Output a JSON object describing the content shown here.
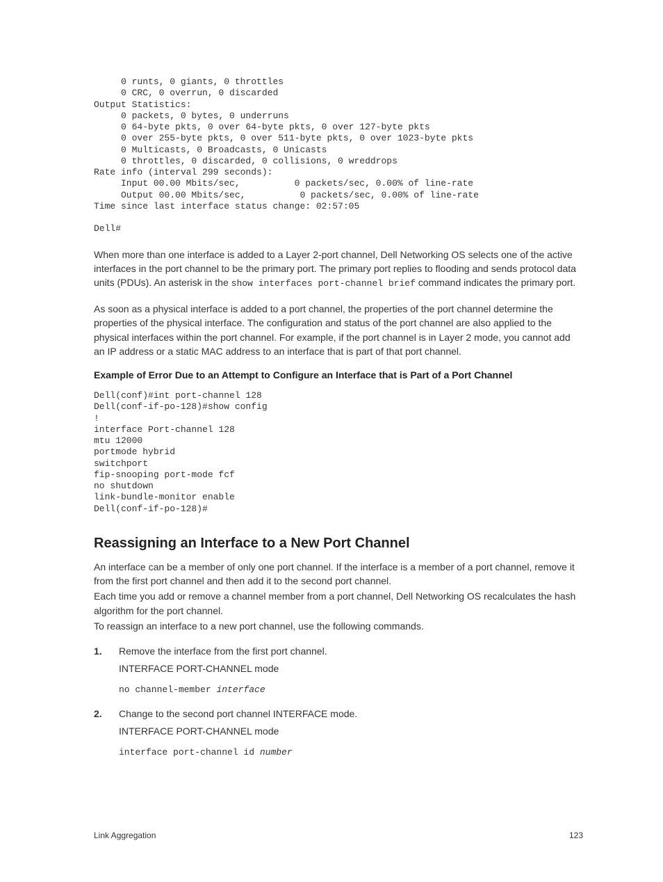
{
  "code_block_top": "     0 runts, 0 giants, 0 throttles\n     0 CRC, 0 overrun, 0 discarded\nOutput Statistics:\n     0 packets, 0 bytes, 0 underruns\n     0 64-byte pkts, 0 over 64-byte pkts, 0 over 127-byte pkts\n     0 over 255-byte pkts, 0 over 511-byte pkts, 0 over 1023-byte pkts\n     0 Multicasts, 0 Broadcasts, 0 Unicasts\n     0 throttles, 0 discarded, 0 collisions, 0 wreddrops\nRate info (interval 299 seconds):\n     Input 00.00 Mbits/sec,          0 packets/sec, 0.00% of line-rate\n     Output 00.00 Mbits/sec,          0 packets/sec, 0.00% of line-rate\nTime since last interface status change: 02:57:05\n\nDell#",
  "para1_a": "When more than one interface is added to a Layer 2-port channel, Dell Networking OS selects one of the active interfaces in the port channel to be the primary port. The primary port replies to flooding and sends protocol data units (PDUs). An asterisk in the ",
  "para1_cmd": "show interfaces port-channel brief",
  "para1_b": " command indicates the primary port.",
  "para2": "As soon as a physical interface is added to a port channel, the properties of the port channel determine the properties of the physical interface. The configuration and status of the port channel are also applied to the physical interfaces within the port channel. For example, if the port channel is in Layer 2 mode, you cannot add an IP address or a static MAC address to an interface that is part of that port channel.",
  "example_heading": "Example of Error Due to an Attempt to Configure an Interface that is Part of a Port Channel",
  "code_block_2": "Dell(conf)#int port-channel 128\nDell(conf-if-po-128)#show config\n!\ninterface Port-channel 128\nmtu 12000\nportmode hybrid\nswitchport\nfip-snooping port-mode fcf\nno shutdown\nlink-bundle-monitor enable\nDell(conf-if-po-128)#",
  "section_heading": "Reassigning an Interface to a New Port Channel",
  "para3": "An interface can be a member of only one port channel. If the interface is a member of a port channel, remove it from the first port channel and then add it to the second port channel.",
  "para4": "Each time you add or remove a channel member from a port channel, Dell Networking OS recalculates the hash algorithm for the port channel.",
  "para5": "To reassign an interface to a new port channel, use the following commands.",
  "step1_num": "1.",
  "step1_text": "Remove the interface from the first port channel.",
  "step1_mode": "INTERFACE PORT-CHANNEL mode",
  "step1_cmd": "no channel-member ",
  "step1_arg": "interface",
  "step2_num": "2.",
  "step2_text": "Change to the second port channel INTERFACE mode.",
  "step2_mode": "INTERFACE PORT-CHANNEL mode",
  "step2_cmd": "interface port-channel id ",
  "step2_arg": "number",
  "footer_left": "Link Aggregation",
  "footer_right": "123"
}
